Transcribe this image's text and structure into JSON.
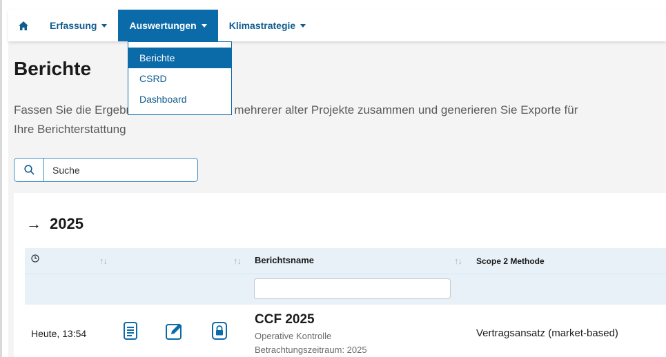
{
  "nav": {
    "home_icon": "home-icon",
    "items": [
      {
        "label": "Erfassung"
      },
      {
        "label": "Auswertungen"
      },
      {
        "label": "Klimastrategie"
      }
    ],
    "active_color": "#0b6aa8",
    "link_color": "#0f5c8f"
  },
  "dropdown": {
    "items": [
      {
        "label": "Berichte"
      },
      {
        "label": "CSRD"
      },
      {
        "label": "Dashboard"
      }
    ]
  },
  "page": {
    "title": "Berichte",
    "description": "Fassen Sie die Ergebnisse einzelner oder mehrerer alter Projekte zusammen und generieren Sie Exporte für Ihre Berichterstattung"
  },
  "search": {
    "placeholder": "Suche",
    "icon": "search-icon"
  },
  "group": {
    "arrow": "→",
    "year": "2025"
  },
  "table": {
    "headers": {
      "time_icon": "clock-icon",
      "name": "Berichtsname",
      "method": "Scope 2 Methode"
    },
    "sort_glyph": "↑↓",
    "rows": [
      {
        "time": "Heute, 13:54",
        "name": "CCF 2025",
        "control": "Operative Kontrolle",
        "period": "Betrachtungszeitraum: 2025",
        "method": "Vertragsansatz (market-based)"
      }
    ]
  }
}
